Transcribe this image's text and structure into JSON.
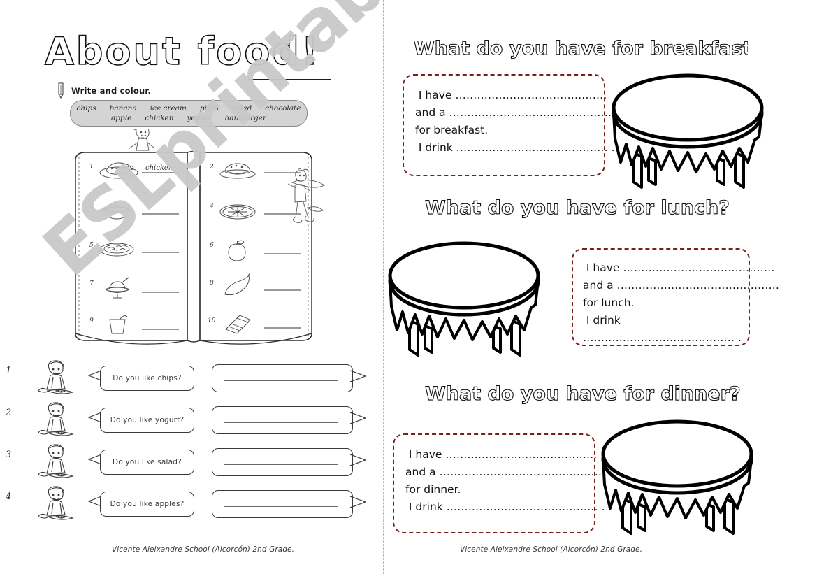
{
  "worksheet": {
    "title": "About food!",
    "instruction": "Write and colour.",
    "name_line_label": "",
    "footer": "Vicente Aleixandre School (Alcorcón)  2nd Grade,",
    "watermark": "ESLprintables.com"
  },
  "word_bank": {
    "row1": [
      "chips",
      "banana",
      "ice cream",
      "pizza",
      "salad",
      "chocolate"
    ],
    "row2": [
      "apple",
      "chicken",
      "yogurt",
      "hamburger"
    ]
  },
  "book_exercise": {
    "left_column": [
      {
        "number": "1",
        "icon": "roast-chicken-icon",
        "answer": "chicken"
      },
      {
        "number": "3",
        "icon": "salad-bowl-icon",
        "answer": ""
      },
      {
        "number": "5",
        "icon": "plate-of-chips-icon",
        "answer": ""
      },
      {
        "number": "7",
        "icon": "ice-cream-sundae-icon",
        "answer": ""
      },
      {
        "number": "9",
        "icon": "yogurt-cup-icon",
        "answer": ""
      }
    ],
    "right_column": [
      {
        "number": "2",
        "icon": "hamburger-icon",
        "answer": ""
      },
      {
        "number": "4",
        "icon": "pizza-icon",
        "answer": ""
      },
      {
        "number": "6",
        "icon": "apple-icon",
        "answer": ""
      },
      {
        "number": "8",
        "icon": "banana-icon",
        "answer": ""
      },
      {
        "number": "10",
        "icon": "chocolate-bar-icon",
        "answer": ""
      }
    ]
  },
  "dialogue_exercise": [
    {
      "number": "1",
      "question": "Do you like chips?",
      "answer": "",
      "end_mark": "."
    },
    {
      "number": "2",
      "question": "Do you like yogurt?",
      "answer": "",
      "end_mark": "."
    },
    {
      "number": "3",
      "question": "Do you like salad?",
      "answer": "",
      "end_mark": "."
    },
    {
      "number": "4",
      "question": "Do you like apples?",
      "answer": "",
      "end_mark": "."
    }
  ],
  "meals": [
    {
      "heading": "What do you have for breakfast?",
      "line1_label": "I have",
      "line1_dots": "……………………………………",
      "line2_label": "and a",
      "line2_dots": "………………………………………",
      "line3": "for breakfast.",
      "line4_label": "I drink",
      "line4_dots": "…………………………………… .",
      "line4_wrapped": false,
      "table_position": "right"
    },
    {
      "heading": "What do you have for lunch?",
      "line1_label": "I have",
      "line1_dots": "……………………………………",
      "line2_label": "and a",
      "line2_dots": "………………………………………",
      "line3": "for lunch.",
      "line4_label": "I drink",
      "line4_dots": "…………………………………… .",
      "line4_wrapped": true,
      "table_position": "left"
    },
    {
      "heading": "What do you have for dinner?",
      "line1_label": "I have",
      "line1_dots": "……………………………………",
      "line2_label": "and a",
      "line2_dots": "………………………………………",
      "line3": "for dinner.",
      "line4_label": "I drink",
      "line4_dots": "…………………………………… .",
      "line4_wrapped": false,
      "table_position": "right"
    }
  ],
  "colors": {
    "dashed_border": "#7a1f1f",
    "word_bank_bg": "#d4d4d4",
    "ink": "#1a1a1a",
    "watermark": "#c9c9c9",
    "divider": "#b6b6b6"
  }
}
